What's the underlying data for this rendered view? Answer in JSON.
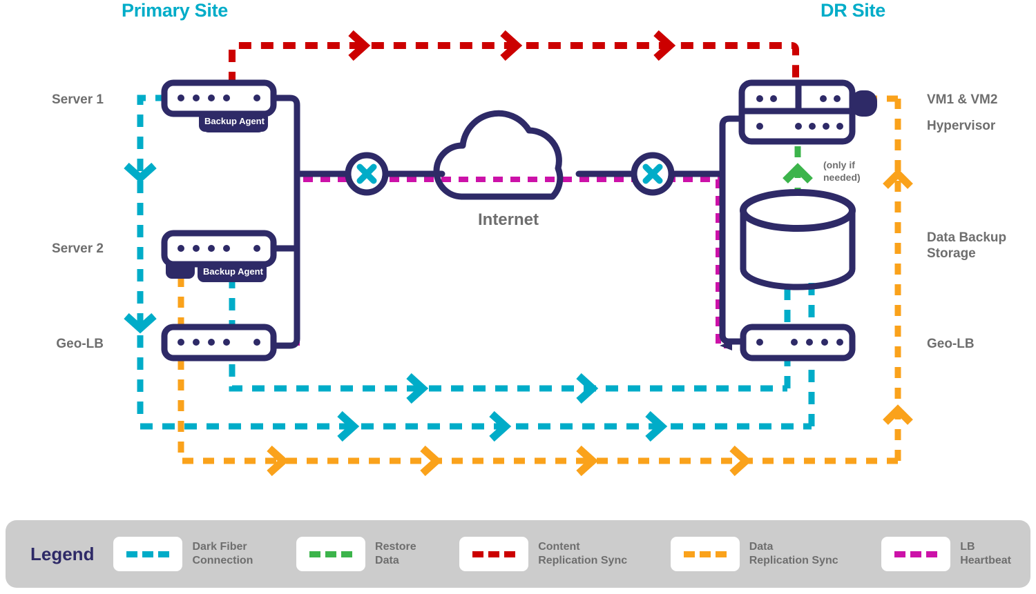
{
  "sites": {
    "primary_title": "Primary Site",
    "dr_title": "DR Site"
  },
  "labels": {
    "server1": "Server 1",
    "server2": "Server 2",
    "geolb_left": "Geo-LB",
    "vm": "VM1 & VM2",
    "hypervisor": "Hypervisor",
    "storage": "Data Backup\nStorage",
    "geolb_right": "Geo-LB",
    "internet": "Internet",
    "only_if_needed": "(only if\nneeded)",
    "backup_agent_1": "Backup Agent",
    "backup_agent_2": "Backup Agent"
  },
  "legend": {
    "title": "Legend",
    "items": [
      {
        "label": "Dark Fiber\nConnection",
        "color": "#00ACC8",
        "name": "dark-fiber-connection"
      },
      {
        "label": "Restore\nData",
        "color": "#3CB44B",
        "name": "restore-data"
      },
      {
        "label": "Content\nReplication Sync",
        "color": "#CC0000",
        "name": "content-replication-sync"
      },
      {
        "label": "Data\nReplication Sync",
        "color": "#FAA21B",
        "name": "data-replication-sync"
      },
      {
        "label": "LB\nHeartbeat",
        "color": "#CC12A8",
        "name": "lb-heartbeat"
      }
    ]
  },
  "colors": {
    "navy": "#2E2A67",
    "cyan": "#00ACC8",
    "green": "#3CB44B",
    "red": "#CC0000",
    "orange": "#FAA21B",
    "magenta": "#CC12A8",
    "grey_text": "#6E6E6E",
    "legend_bg": "#CCCCCC",
    "white": "#FFFFFF"
  },
  "diagram": {
    "type": "network-topology",
    "nodes": [
      {
        "name": "server-1",
        "site": "primary",
        "kind": "server",
        "has_backup_agent": true
      },
      {
        "name": "server-2",
        "site": "primary",
        "kind": "server",
        "has_backup_agent": true
      },
      {
        "name": "geo-lb-primary",
        "site": "primary",
        "kind": "load-balancer"
      },
      {
        "name": "internet-cloud",
        "site": "wan",
        "kind": "cloud"
      },
      {
        "name": "firewall-primary",
        "site": "wan",
        "kind": "firewall"
      },
      {
        "name": "firewall-dr",
        "site": "wan",
        "kind": "firewall"
      },
      {
        "name": "hypervisor-vm",
        "site": "dr",
        "kind": "hypervisor"
      },
      {
        "name": "data-backup-storage",
        "site": "dr",
        "kind": "storage"
      },
      {
        "name": "geo-lb-dr",
        "site": "dr",
        "kind": "load-balancer"
      }
    ],
    "links": [
      {
        "from": "server-1",
        "to": "hypervisor-vm",
        "type": "content-replication-sync",
        "color": "#CC0000"
      },
      {
        "from": "data-backup-storage",
        "to": "hypervisor-vm",
        "type": "restore-data",
        "color": "#3CB44B"
      },
      {
        "from": "geo-lb-primary",
        "to": "geo-lb-dr",
        "type": "lb-heartbeat",
        "color": "#CC12A8"
      },
      {
        "from": "server-2",
        "to": "data-backup-storage",
        "type": "data-replication-sync",
        "color": "#FAA21B"
      },
      {
        "from": "primary-stack",
        "to": "dr-stack",
        "type": "dark-fiber-connection",
        "color": "#00ACC8"
      }
    ]
  }
}
